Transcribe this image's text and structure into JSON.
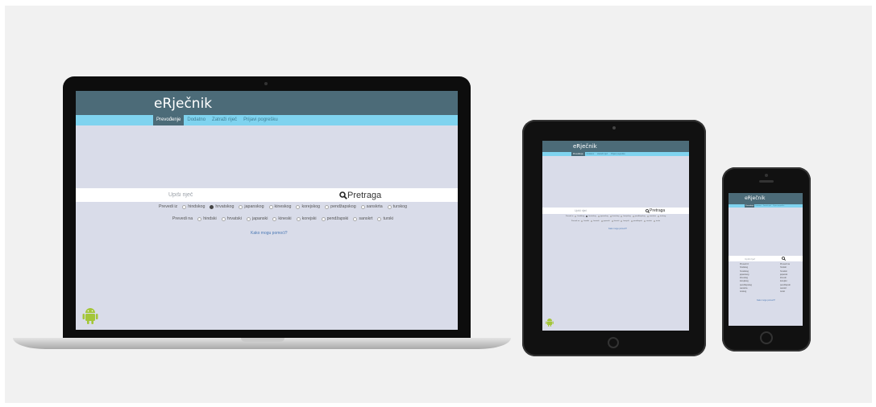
{
  "site": {
    "logo": "eRječnik",
    "nav": [
      "Prevođenje",
      "Dodatno",
      "Zatraži riječ",
      "Prijavi pogrešku"
    ],
    "search_placeholder": "Upiši riječ",
    "search_button": "Pretraga",
    "from_label": "Prevedi iz",
    "to_label": "Prevedi na",
    "from_langs": [
      "hindskog",
      "hrvatskog",
      "japanskog",
      "kineskog",
      "korejskog",
      "pendžapskog",
      "sanskrta",
      "turskog"
    ],
    "to_langs": [
      "hindski",
      "hrvatski",
      "japanski",
      "kineski",
      "korejski",
      "pendžapski",
      "sanskrt",
      "turski"
    ],
    "from_selected": 1,
    "help_link": "Kako mogu pomoći?"
  },
  "colors": {
    "header": "#4c6b78",
    "nav": "#7fd3ef",
    "page_bg": "#d9dce9",
    "android": "#a4c639"
  },
  "icons": [
    "search-icon",
    "android-icon"
  ]
}
